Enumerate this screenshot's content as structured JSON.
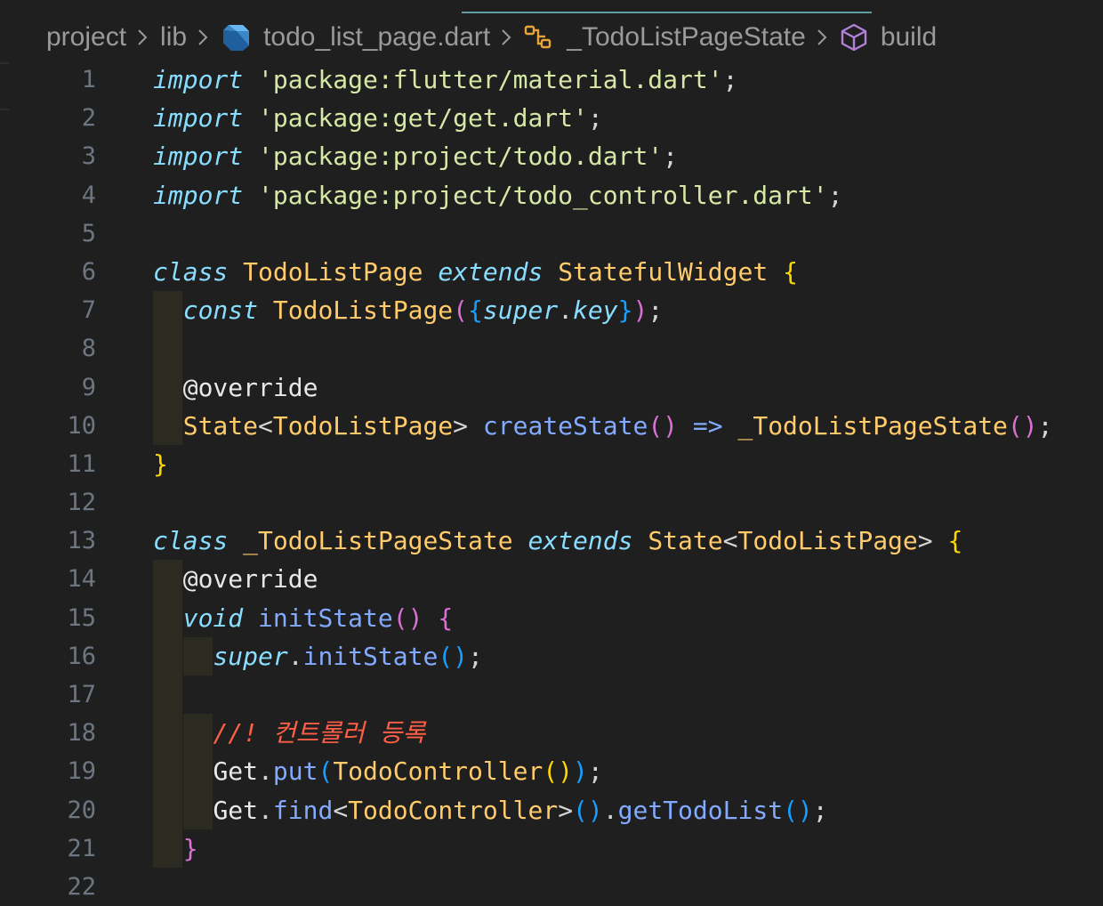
{
  "breadcrumb": {
    "items": [
      {
        "label": "project",
        "icon": ""
      },
      {
        "label": "lib",
        "icon": ""
      },
      {
        "label": "todo_list_page.dart",
        "icon": "dart-file-icon"
      },
      {
        "label": "_TodoListPageState",
        "icon": "class-symbol-icon"
      },
      {
        "label": "build",
        "icon": "method-cube-icon"
      }
    ]
  },
  "colors": {
    "background": "#1f1f1f",
    "keyword": "#89ddff",
    "string": "#d7e8a6",
    "class": "#ffcb6b",
    "function": "#82aaff",
    "comment": "#ff5f46",
    "bracket_level1": "#ffd700",
    "bracket_level2": "#da70d6",
    "bracket_level3": "#179fff",
    "line_number": "#6e7681"
  },
  "editor": {
    "lines": [
      {
        "num": "1",
        "guides": 0,
        "tokens": [
          [
            "kw",
            "import"
          ],
          [
            "pn",
            " "
          ],
          [
            "str",
            "'package:flutter/material.dart'"
          ],
          [
            "pn",
            ";"
          ]
        ]
      },
      {
        "num": "2",
        "guides": 0,
        "tokens": [
          [
            "kw",
            "import"
          ],
          [
            "pn",
            " "
          ],
          [
            "str",
            "'package:get/get.dart'"
          ],
          [
            "pn",
            ";"
          ]
        ]
      },
      {
        "num": "3",
        "guides": 0,
        "tokens": [
          [
            "kw",
            "import"
          ],
          [
            "pn",
            " "
          ],
          [
            "str",
            "'package:project/todo.dart'"
          ],
          [
            "pn",
            ";"
          ]
        ]
      },
      {
        "num": "4",
        "guides": 0,
        "tokens": [
          [
            "kw",
            "import"
          ],
          [
            "pn",
            " "
          ],
          [
            "str",
            "'package:project/todo_controller.dart'"
          ],
          [
            "pn",
            ";"
          ]
        ]
      },
      {
        "num": "5",
        "guides": 0,
        "tokens": []
      },
      {
        "num": "6",
        "guides": 0,
        "tokens": [
          [
            "kw",
            "class"
          ],
          [
            "pn",
            " "
          ],
          [
            "cls",
            "TodoListPage"
          ],
          [
            "pn",
            " "
          ],
          [
            "kw",
            "extends"
          ],
          [
            "pn",
            " "
          ],
          [
            "cls",
            "StatefulWidget"
          ],
          [
            "pn",
            " "
          ],
          [
            "b1",
            "{"
          ]
        ]
      },
      {
        "num": "7",
        "guides": 1,
        "tokens": [
          [
            "pn",
            "  "
          ],
          [
            "kw",
            "const"
          ],
          [
            "pn",
            " "
          ],
          [
            "cls",
            "TodoListPage"
          ],
          [
            "b2",
            "("
          ],
          [
            "b3",
            "{"
          ],
          [
            "kw",
            "super"
          ],
          [
            "pn",
            "."
          ],
          [
            "kw",
            "key"
          ],
          [
            "b3",
            "}"
          ],
          [
            "b2",
            ")"
          ],
          [
            "pn",
            ";"
          ]
        ]
      },
      {
        "num": "8",
        "guides": 1,
        "tokens": []
      },
      {
        "num": "9",
        "guides": 1,
        "tokens": [
          [
            "pn",
            "  "
          ],
          [
            "plain",
            "@override"
          ]
        ]
      },
      {
        "num": "10",
        "guides": 1,
        "tokens": [
          [
            "pn",
            "  "
          ],
          [
            "cls",
            "State"
          ],
          [
            "pn",
            "<"
          ],
          [
            "cls",
            "TodoListPage"
          ],
          [
            "pn",
            "> "
          ],
          [
            "fn",
            "createState"
          ],
          [
            "b2",
            "()"
          ],
          [
            "pn",
            " "
          ],
          [
            "fn",
            "=>"
          ],
          [
            "pn",
            " "
          ],
          [
            "cls",
            "_TodoListPageState"
          ],
          [
            "b2",
            "()"
          ],
          [
            "pn",
            ";"
          ]
        ]
      },
      {
        "num": "11",
        "guides": 0,
        "tokens": [
          [
            "b1",
            "}"
          ]
        ]
      },
      {
        "num": "12",
        "guides": 0,
        "tokens": []
      },
      {
        "num": "13",
        "guides": 0,
        "tokens": [
          [
            "kw",
            "class"
          ],
          [
            "pn",
            " "
          ],
          [
            "cls",
            "_TodoListPageState"
          ],
          [
            "pn",
            " "
          ],
          [
            "kw",
            "extends"
          ],
          [
            "pn",
            " "
          ],
          [
            "cls",
            "State"
          ],
          [
            "pn",
            "<"
          ],
          [
            "cls",
            "TodoListPage"
          ],
          [
            "pn",
            "> "
          ],
          [
            "b1",
            "{"
          ]
        ]
      },
      {
        "num": "14",
        "guides": 1,
        "tokens": [
          [
            "pn",
            "  "
          ],
          [
            "plain",
            "@override"
          ]
        ]
      },
      {
        "num": "15",
        "guides": 1,
        "tokens": [
          [
            "pn",
            "  "
          ],
          [
            "kw",
            "void"
          ],
          [
            "pn",
            " "
          ],
          [
            "fn",
            "initState"
          ],
          [
            "b2",
            "()"
          ],
          [
            "pn",
            " "
          ],
          [
            "b2",
            "{"
          ]
        ]
      },
      {
        "num": "16",
        "guides": 2,
        "tokens": [
          [
            "pn",
            "    "
          ],
          [
            "kw",
            "super"
          ],
          [
            "pn",
            "."
          ],
          [
            "fn",
            "initState"
          ],
          [
            "b3",
            "()"
          ],
          [
            "pn",
            ";"
          ]
        ]
      },
      {
        "num": "17",
        "guides": 1,
        "tokens": []
      },
      {
        "num": "18",
        "guides": 2,
        "tokens": [
          [
            "pn",
            "    "
          ],
          [
            "cm",
            "//! 컨트롤러 등록"
          ]
        ]
      },
      {
        "num": "19",
        "guides": 2,
        "tokens": [
          [
            "pn",
            "    "
          ],
          [
            "plain",
            "Get"
          ],
          [
            "pn",
            "."
          ],
          [
            "fn",
            "put"
          ],
          [
            "b3",
            "("
          ],
          [
            "cls",
            "TodoController"
          ],
          [
            "b1",
            "()"
          ],
          [
            "b3",
            ")"
          ],
          [
            "pn",
            ";"
          ]
        ]
      },
      {
        "num": "20",
        "guides": 2,
        "tokens": [
          [
            "pn",
            "    "
          ],
          [
            "plain",
            "Get"
          ],
          [
            "pn",
            "."
          ],
          [
            "fn",
            "find"
          ],
          [
            "pn",
            "<"
          ],
          [
            "cls",
            "TodoController"
          ],
          [
            "pn",
            ">"
          ],
          [
            "b3",
            "()"
          ],
          [
            "pn",
            "."
          ],
          [
            "fn",
            "getTodoList"
          ],
          [
            "b3",
            "()"
          ],
          [
            "pn",
            ";"
          ]
        ]
      },
      {
        "num": "21",
        "guides": 1,
        "tokens": [
          [
            "pn",
            "  "
          ],
          [
            "b2",
            "}"
          ]
        ]
      },
      {
        "num": "22",
        "guides": 0,
        "tokens": []
      }
    ]
  }
}
